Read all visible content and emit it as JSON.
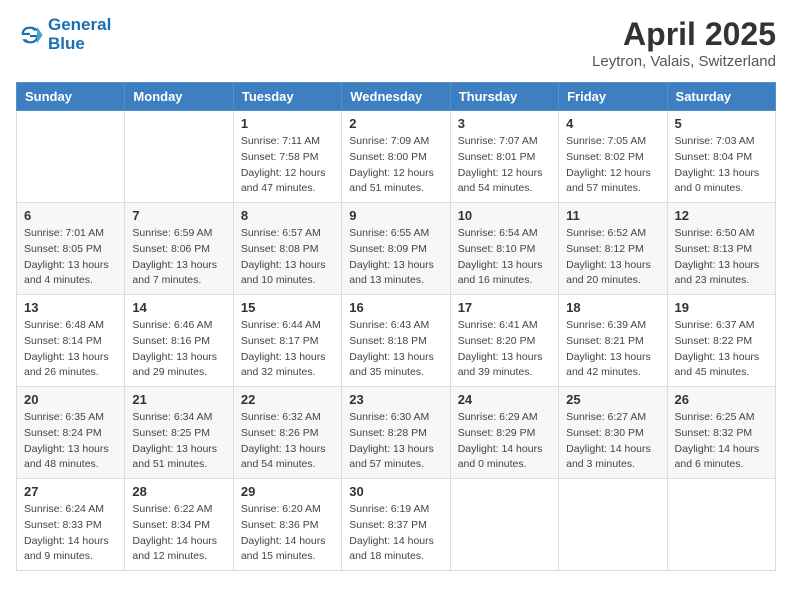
{
  "header": {
    "logo_line1": "General",
    "logo_line2": "Blue",
    "month": "April 2025",
    "location": "Leytron, Valais, Switzerland"
  },
  "weekdays": [
    "Sunday",
    "Monday",
    "Tuesday",
    "Wednesday",
    "Thursday",
    "Friday",
    "Saturday"
  ],
  "weeks": [
    [
      {
        "day": "",
        "info": ""
      },
      {
        "day": "",
        "info": ""
      },
      {
        "day": "1",
        "info": "Sunrise: 7:11 AM\nSunset: 7:58 PM\nDaylight: 12 hours and 47 minutes."
      },
      {
        "day": "2",
        "info": "Sunrise: 7:09 AM\nSunset: 8:00 PM\nDaylight: 12 hours and 51 minutes."
      },
      {
        "day": "3",
        "info": "Sunrise: 7:07 AM\nSunset: 8:01 PM\nDaylight: 12 hours and 54 minutes."
      },
      {
        "day": "4",
        "info": "Sunrise: 7:05 AM\nSunset: 8:02 PM\nDaylight: 12 hours and 57 minutes."
      },
      {
        "day": "5",
        "info": "Sunrise: 7:03 AM\nSunset: 8:04 PM\nDaylight: 13 hours and 0 minutes."
      }
    ],
    [
      {
        "day": "6",
        "info": "Sunrise: 7:01 AM\nSunset: 8:05 PM\nDaylight: 13 hours and 4 minutes."
      },
      {
        "day": "7",
        "info": "Sunrise: 6:59 AM\nSunset: 8:06 PM\nDaylight: 13 hours and 7 minutes."
      },
      {
        "day": "8",
        "info": "Sunrise: 6:57 AM\nSunset: 8:08 PM\nDaylight: 13 hours and 10 minutes."
      },
      {
        "day": "9",
        "info": "Sunrise: 6:55 AM\nSunset: 8:09 PM\nDaylight: 13 hours and 13 minutes."
      },
      {
        "day": "10",
        "info": "Sunrise: 6:54 AM\nSunset: 8:10 PM\nDaylight: 13 hours and 16 minutes."
      },
      {
        "day": "11",
        "info": "Sunrise: 6:52 AM\nSunset: 8:12 PM\nDaylight: 13 hours and 20 minutes."
      },
      {
        "day": "12",
        "info": "Sunrise: 6:50 AM\nSunset: 8:13 PM\nDaylight: 13 hours and 23 minutes."
      }
    ],
    [
      {
        "day": "13",
        "info": "Sunrise: 6:48 AM\nSunset: 8:14 PM\nDaylight: 13 hours and 26 minutes."
      },
      {
        "day": "14",
        "info": "Sunrise: 6:46 AM\nSunset: 8:16 PM\nDaylight: 13 hours and 29 minutes."
      },
      {
        "day": "15",
        "info": "Sunrise: 6:44 AM\nSunset: 8:17 PM\nDaylight: 13 hours and 32 minutes."
      },
      {
        "day": "16",
        "info": "Sunrise: 6:43 AM\nSunset: 8:18 PM\nDaylight: 13 hours and 35 minutes."
      },
      {
        "day": "17",
        "info": "Sunrise: 6:41 AM\nSunset: 8:20 PM\nDaylight: 13 hours and 39 minutes."
      },
      {
        "day": "18",
        "info": "Sunrise: 6:39 AM\nSunset: 8:21 PM\nDaylight: 13 hours and 42 minutes."
      },
      {
        "day": "19",
        "info": "Sunrise: 6:37 AM\nSunset: 8:22 PM\nDaylight: 13 hours and 45 minutes."
      }
    ],
    [
      {
        "day": "20",
        "info": "Sunrise: 6:35 AM\nSunset: 8:24 PM\nDaylight: 13 hours and 48 minutes."
      },
      {
        "day": "21",
        "info": "Sunrise: 6:34 AM\nSunset: 8:25 PM\nDaylight: 13 hours and 51 minutes."
      },
      {
        "day": "22",
        "info": "Sunrise: 6:32 AM\nSunset: 8:26 PM\nDaylight: 13 hours and 54 minutes."
      },
      {
        "day": "23",
        "info": "Sunrise: 6:30 AM\nSunset: 8:28 PM\nDaylight: 13 hours and 57 minutes."
      },
      {
        "day": "24",
        "info": "Sunrise: 6:29 AM\nSunset: 8:29 PM\nDaylight: 14 hours and 0 minutes."
      },
      {
        "day": "25",
        "info": "Sunrise: 6:27 AM\nSunset: 8:30 PM\nDaylight: 14 hours and 3 minutes."
      },
      {
        "day": "26",
        "info": "Sunrise: 6:25 AM\nSunset: 8:32 PM\nDaylight: 14 hours and 6 minutes."
      }
    ],
    [
      {
        "day": "27",
        "info": "Sunrise: 6:24 AM\nSunset: 8:33 PM\nDaylight: 14 hours and 9 minutes."
      },
      {
        "day": "28",
        "info": "Sunrise: 6:22 AM\nSunset: 8:34 PM\nDaylight: 14 hours and 12 minutes."
      },
      {
        "day": "29",
        "info": "Sunrise: 6:20 AM\nSunset: 8:36 PM\nDaylight: 14 hours and 15 minutes."
      },
      {
        "day": "30",
        "info": "Sunrise: 6:19 AM\nSunset: 8:37 PM\nDaylight: 14 hours and 18 minutes."
      },
      {
        "day": "",
        "info": ""
      },
      {
        "day": "",
        "info": ""
      },
      {
        "day": "",
        "info": ""
      }
    ]
  ]
}
